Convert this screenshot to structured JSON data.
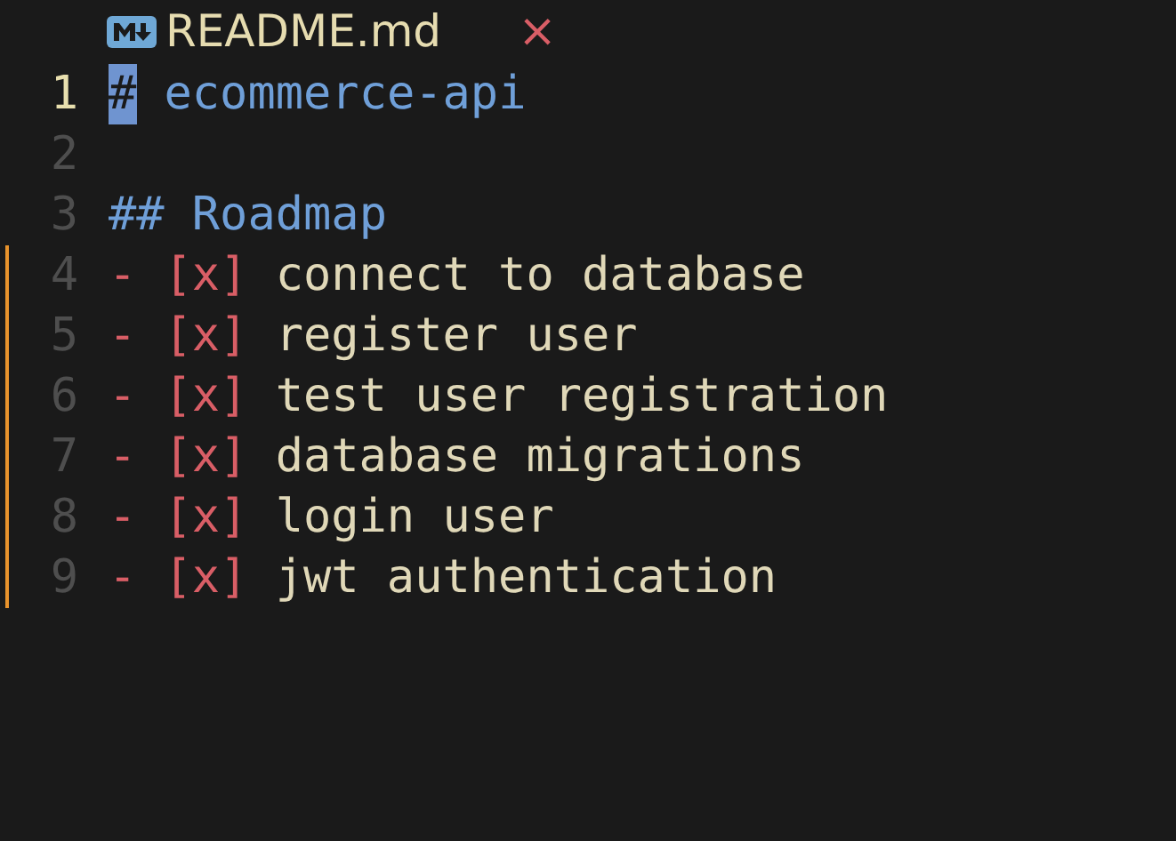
{
  "tab": {
    "title": "README.md",
    "close": "×"
  },
  "lines": [
    {
      "number": "1",
      "active": true,
      "modified": false,
      "tokens": [
        {
          "kind": "heading-marker",
          "text": "#",
          "selected": true
        },
        {
          "kind": "heading",
          "text": "ecommerce-api",
          "selected": false
        }
      ]
    },
    {
      "number": "2",
      "active": false,
      "modified": false
    },
    {
      "number": "3",
      "active": false,
      "modified": false,
      "tokens": [
        {
          "kind": "heading-marker",
          "text": "##",
          "selected": false
        },
        {
          "kind": "heading",
          "text": "Roadmap",
          "selected": false
        }
      ]
    },
    {
      "number": "4",
      "active": false,
      "modified": true,
      "tokens": [
        {
          "kind": "bullet",
          "text": "-",
          "selected": false
        },
        {
          "kind": "checkbox",
          "text": "[x]",
          "selected": false
        },
        {
          "kind": "text",
          "text": "connect to database",
          "selected": false
        }
      ]
    },
    {
      "number": "5",
      "active": false,
      "modified": true,
      "tokens": [
        {
          "kind": "bullet",
          "text": "-",
          "selected": false
        },
        {
          "kind": "checkbox",
          "text": "[x]",
          "selected": false
        },
        {
          "kind": "text",
          "text": "register user",
          "selected": false
        }
      ]
    },
    {
      "number": "6",
      "active": false,
      "modified": true,
      "tokens": [
        {
          "kind": "bullet",
          "text": "-",
          "selected": false
        },
        {
          "kind": "checkbox",
          "text": "[x]",
          "selected": false
        },
        {
          "kind": "text",
          "text": "test user registration",
          "selected": false
        }
      ]
    },
    {
      "number": "7",
      "active": false,
      "modified": true,
      "tokens": [
        {
          "kind": "bullet",
          "text": "-",
          "selected": false
        },
        {
          "kind": "checkbox",
          "text": "[x]",
          "selected": false
        },
        {
          "kind": "text",
          "text": "database migrations",
          "selected": false
        }
      ]
    },
    {
      "number": "8",
      "active": false,
      "modified": true,
      "tokens": [
        {
          "kind": "bullet",
          "text": "-",
          "selected": false
        },
        {
          "kind": "checkbox",
          "text": "[x]",
          "selected": false
        },
        {
          "kind": "text",
          "text": "login user",
          "selected": false
        }
      ]
    },
    {
      "number": "9",
      "active": false,
      "modified": true,
      "tokens": [
        {
          "kind": "bullet",
          "text": "-",
          "selected": false
        },
        {
          "kind": "checkbox",
          "text": "[x]",
          "selected": false
        },
        {
          "kind": "text",
          "text": "jwt authentication",
          "selected": false
        }
      ]
    }
  ]
}
